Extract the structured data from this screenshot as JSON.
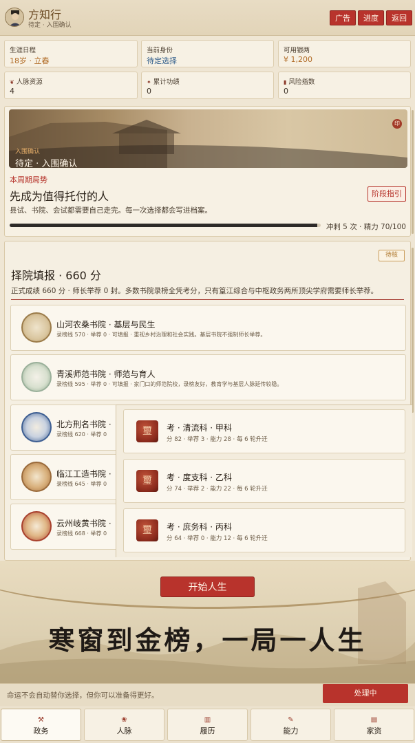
{
  "header": {
    "name": "方知行",
    "status": "待定 · 入围确认",
    "buttons": {
      "ad": "广告",
      "progress": "进度",
      "back": "返回"
    }
  },
  "stats": [
    {
      "label": "生涯日程",
      "value": "18岁 · 立春"
    },
    {
      "label": "当前身份",
      "value": "待定选择"
    },
    {
      "label": "可用银两",
      "value": "¥ 1,200"
    },
    {
      "label": "人脉资源",
      "value": "4"
    },
    {
      "label": "累计功绩",
      "value": "0"
    },
    {
      "label": "风险指数",
      "value": "0"
    }
  ],
  "hero": {
    "banner_tag": "入围确认",
    "banner_title": "待定 · 入围确认",
    "week_label": "本周期局势",
    "goal": "先成为值得托付的人",
    "stage_button": "阶段指引",
    "desc": "县试、书院、会试都需要自己走完。每一次选择都会写进档案。",
    "progress_fraction": 0.99,
    "progress_text": "冲刺 5 次 · 精力 70/100"
  },
  "panel": {
    "badge": "待核",
    "title": "择院填报 · 660 分",
    "desc": "正式成绩 660 分 · 师长举荐 0 封。多数书院录榜全凭考分，只有篁江综合与中枢政务两所顶尖学府需要师长举荐。",
    "academies": [
      {
        "name": "山河农桑书院 · 基层与民生",
        "sub": "录榜线 570 · 举荐 0 · 可填报 · 重视乡村治理和社会实践。基层书院不强制师长举荐。"
      },
      {
        "name": "青溪师范书院 · 师范与育人",
        "sub": "录榜线 595 · 举荐 0 · 可填报 · 家门口的师范院校，录榜友好，教育学与基层人脉延传较稳。"
      },
      {
        "name": "北方刑名书院 ·",
        "sub": "录榜线 620 · 举荐 0"
      },
      {
        "name": "临江工造书院 ·",
        "sub": "录榜线 645 · 举荐 0"
      },
      {
        "name": "云州岐黄书院 ·",
        "sub": "录榜线 668 · 举荐 0"
      }
    ],
    "subjects": [
      {
        "seal": "璽",
        "name": "考 · 清流科 · 甲科",
        "sub": "分 82 · 举荐 3 · 能力 28 · 每 6 轮升迁"
      },
      {
        "seal": "璽",
        "name": "考 · 度支科 · 乙科",
        "sub": "分 74 · 举荐 2 · 能力 22 · 每 6 轮升迁"
      },
      {
        "seal": "璽",
        "name": "考 · 庶务科 · 丙科",
        "sub": "分 64 · 举荐 0 · 能力 12 · 每 6 轮升迁"
      }
    ]
  },
  "start_button": "开始人生",
  "slogan": "寒窗到金榜，一局一人生",
  "footer": {
    "note": "命运不会自动替你选择，但你可以准备得更好。",
    "process_button": "处理中"
  },
  "nav": [
    {
      "label": "政务",
      "icon": "crossed-tools-icon",
      "glyph": "⚒"
    },
    {
      "label": "人脉",
      "icon": "people-icon",
      "glyph": "❀"
    },
    {
      "label": "履历",
      "icon": "scroll-icon",
      "glyph": "▥"
    },
    {
      "label": "能力",
      "icon": "brush-icon",
      "glyph": "✎"
    },
    {
      "label": "家资",
      "icon": "book-icon",
      "glyph": "▤"
    }
  ]
}
